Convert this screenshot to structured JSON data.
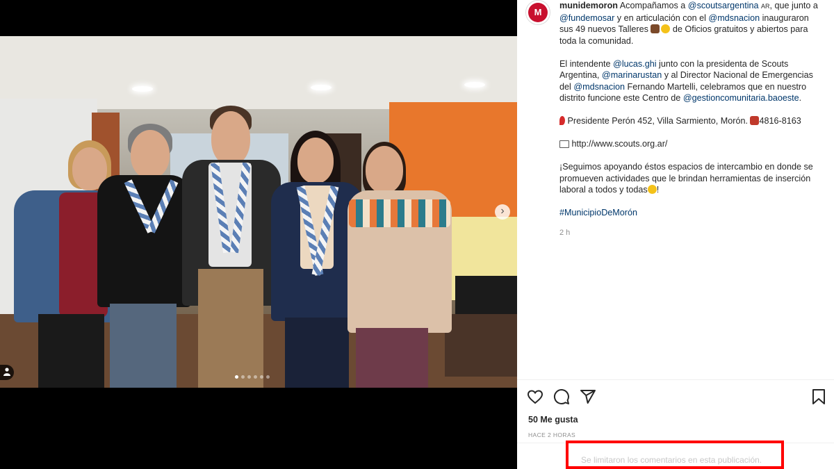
{
  "post": {
    "username": "munidemoron",
    "avatar_label": "M",
    "caption": {
      "p1_a": "Acompañamos a ",
      "p1_m1": "@scoutsargentina",
      "p1_ar": "AR",
      "p1_b": ", que junto a ",
      "p1_m2": "@fundemosar",
      "p1_c": " y en articulación con el ",
      "p1_m3": "@mdsnacion",
      "p1_d": " inauguraron sus 49 nuevos Talleres ",
      "p1_e": " de Oficios gratuitos y abiertos para toda la comunidad.",
      "p2_a": "El intendente ",
      "p2_m1": "@lucas.ghi",
      "p2_b": " junto con la presidenta de Scouts Argentina, ",
      "p2_m2": "@marinarustan",
      "p2_c": " y al Director Nacional de Emergencias del ",
      "p2_m3": "@mdsnacion",
      "p2_d": " Fernando Martelli, celebramos que en nuestro distrito funcione este Centro de ",
      "p2_m4": "@gestioncomunitaria.baoeste",
      "p2_e": ".",
      "p3_address": " Presidente Perón 452, Villa Sarmiento, Morón. ",
      "p3_phone": "4816-8163",
      "p4_url": " http://www.scouts.org.ar/",
      "p5_text": "¡Seguimos apoyando éstos espacios de intercambio en donde se promueven actividades que le brindan herramientas de inserción laboral a todos y todas",
      "p5_end": "!",
      "p6_hashtag": "#MunicipioDeMorón"
    },
    "time_ago": "2 h",
    "likes": "50 Me gusta",
    "posted": "HACE 2 HORAS",
    "comments_limited": "Se limitaron los comentarios en esta publicación."
  },
  "carousel": {
    "next_icon": "›",
    "slides": 6,
    "active_slide": 1,
    "tag_icon": "person-icon"
  },
  "colors": {
    "mention": "#00376b",
    "brand_red": "#c8102e",
    "highlight": "#ff0000"
  }
}
